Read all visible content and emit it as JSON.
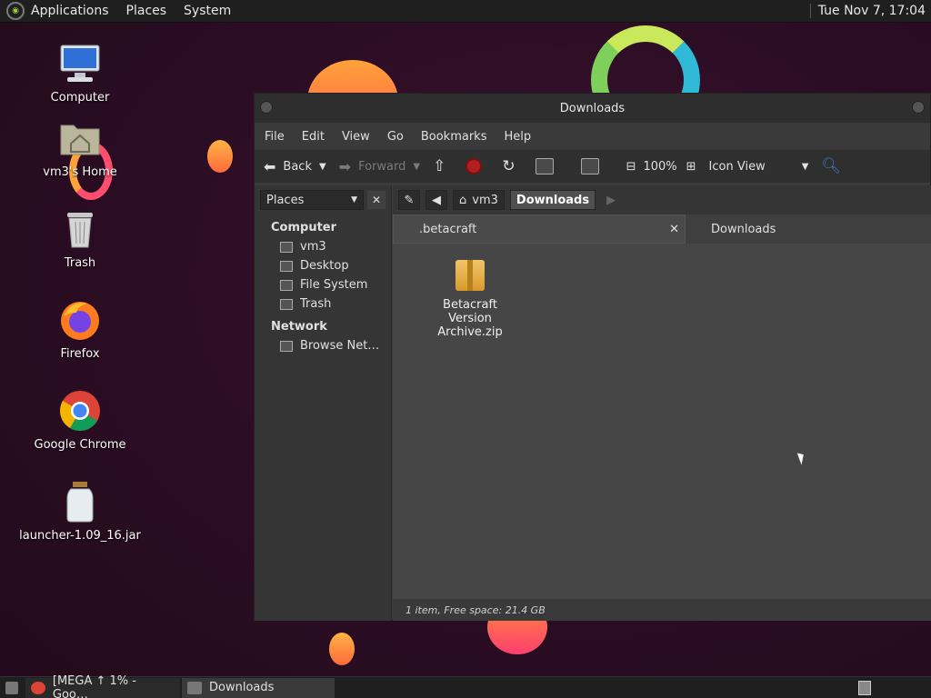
{
  "top_panel": {
    "menus": [
      "Applications",
      "Places",
      "System"
    ],
    "clock": "Tue Nov  7, 17:04"
  },
  "desktop": {
    "icons": [
      {
        "label": "Computer",
        "icon": "computer-icon"
      },
      {
        "label": "vm3's Home",
        "icon": "home-folder-icon"
      },
      {
        "label": "Trash",
        "icon": "trash-icon"
      },
      {
        "label": "Firefox",
        "icon": "firefox-icon"
      },
      {
        "label": "Google Chrome",
        "icon": "chrome-icon"
      },
      {
        "label": "launcher-1.09_16.jar",
        "icon": "jar-icon"
      }
    ]
  },
  "window": {
    "title": "Downloads",
    "menu": [
      "File",
      "Edit",
      "View",
      "Go",
      "Bookmarks",
      "Help"
    ],
    "toolbar": {
      "back": "Back",
      "forward": "Forward",
      "zoom": "100%",
      "view_mode": "Icon View"
    },
    "sidebar": {
      "places_label": "Places",
      "sections": [
        {
          "title": "Computer",
          "items": [
            "vm3",
            "Desktop",
            "File System",
            "Trash"
          ]
        },
        {
          "title": "Network",
          "items": [
            "Browse Net…"
          ]
        }
      ]
    },
    "pathbar": [
      "vm3",
      "Downloads"
    ],
    "tabs": [
      ".betacraft",
      "Downloads"
    ],
    "files": [
      {
        "name": "Betacraft Version Archive.zip",
        "icon": "zip-archive-icon"
      }
    ],
    "status": "1 item, Free space: 21.4 GB"
  },
  "taskbar": {
    "items": [
      "[MEGA ↑ 1% - Goo…",
      "Downloads"
    ]
  }
}
